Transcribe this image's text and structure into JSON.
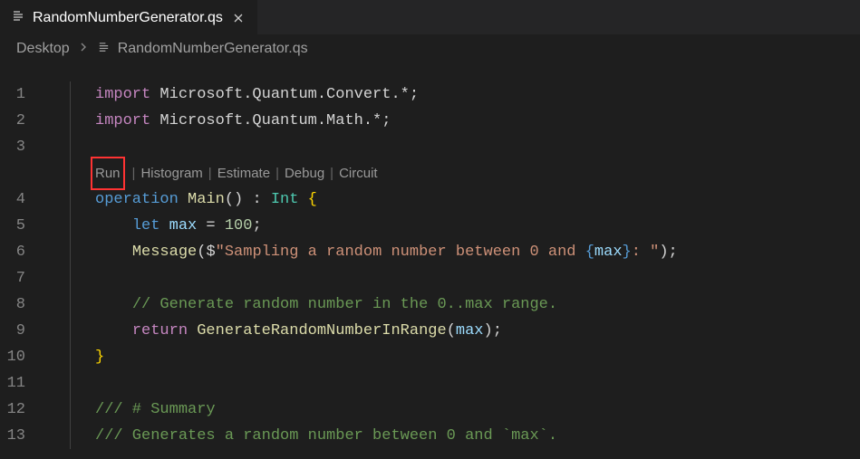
{
  "tab": {
    "filename": "RandomNumberGenerator.qs"
  },
  "breadcrumb": {
    "root": "Desktop",
    "file": "RandomNumberGenerator.qs"
  },
  "codelens": {
    "run": "Run",
    "histogram": "Histogram",
    "estimate": "Estimate",
    "debug": "Debug",
    "circuit": "Circuit"
  },
  "line_numbers": [
    "1",
    "2",
    "3",
    "4",
    "5",
    "6",
    "7",
    "8",
    "9",
    "10",
    "11",
    "12",
    "13"
  ],
  "code": {
    "l1": {
      "pad": "",
      "kw": "import",
      "ns": " Microsoft.Quantum.Convert.*;"
    },
    "l2": {
      "pad": "",
      "kw": "import",
      "ns": " Microsoft.Quantum.Math.*;"
    },
    "l4": {
      "pad": "",
      "kw": "operation",
      "sp": " ",
      "name": "Main",
      "args": "() : ",
      "type": "Int",
      "sp2": " ",
      "brace": "{"
    },
    "l5": {
      "pad": "    ",
      "kw": "let",
      "sp": " ",
      "var": "max",
      "eq": " = ",
      "num": "100",
      "semi": ";"
    },
    "l6": {
      "pad": "    ",
      "fn": "Message",
      "open": "(",
      "dollar": "$",
      "str": "\"Sampling a random number between 0 and ",
      "interp_open": "{",
      "var": "max",
      "interp_close": "}",
      "str2": ": \"",
      "close": ");"
    },
    "l8": {
      "pad": "    ",
      "comment": "// Generate random number in the 0..max range."
    },
    "l9": {
      "pad": "    ",
      "kw": "return",
      "sp": " ",
      "fn": "GenerateRandomNumberInRange",
      "open": "(",
      "var": "max",
      "close": ");"
    },
    "l10": {
      "pad": "",
      "brace": "}"
    },
    "l12": {
      "pad": "",
      "comment": "/// # Summary"
    },
    "l13": {
      "pad": "",
      "comment": "/// Generates a random number between 0 and `max`."
    }
  }
}
